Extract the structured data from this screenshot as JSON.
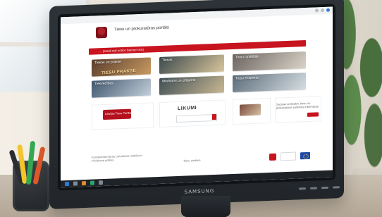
{
  "site": {
    "title": "Tiesu un prokuratūras portāls",
    "banner_text": "… (small red notice banner text)",
    "tiles": [
      {
        "label": "Tiesas un prakse"
      },
      {
        "label": "Tiesas"
      },
      {
        "label": "Tiesu izpildītāji"
      },
      {
        "label": "Tiesvedības"
      },
      {
        "label": "Mediatori un izlīgums"
      },
      {
        "label": "Tiesu ekspertu"
      }
    ],
    "highlight_text": "TIESU PRAKSE",
    "cards": {
      "left_logo_text": "Latvijas Tiesu Portāls",
      "middle_logo_text": "LIKUMI",
      "right_text": "Saziņas ar tiesām, tiesu un prokuratūras sistēmas informācija",
      "right_button": "Pieteikties"
    },
    "footer": {
      "left_text": "Kontaktinformācija\nLietošanas noteikumi\nPrivātuma politika",
      "center_text": "Tiesu sistēma"
    }
  },
  "device": {
    "brand": "SAMSUNG"
  }
}
